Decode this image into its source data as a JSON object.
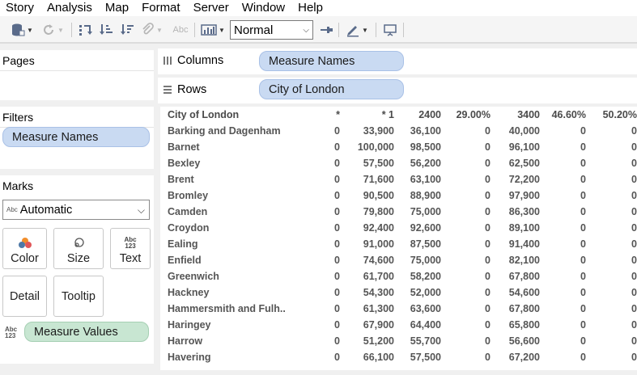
{
  "menu": [
    "Story",
    "Analysis",
    "Map",
    "Format",
    "Server",
    "Window",
    "Help"
  ],
  "toolbar": {
    "fit": "Normal",
    "abc_label": "Abc"
  },
  "panels": {
    "pages": "Pages",
    "filters": "Filters",
    "marks": "Marks"
  },
  "filters": {
    "pill": "Measure Names"
  },
  "marks": {
    "type": "Automatic",
    "type_icon": "Abc",
    "buttons": {
      "color": "Color",
      "size": "Size",
      "text": "Text",
      "detail": "Detail",
      "tooltip": "Tooltip"
    },
    "text_icon_top": "Abc",
    "text_icon_bottom": "123",
    "measure_values_pill": "Measure Values"
  },
  "shelves": {
    "columns_label": "Columns",
    "columns_pill": "Measure Names",
    "rows_label": "Rows",
    "rows_pill": "City of London"
  },
  "table": {
    "headers": [
      "City of London",
      "*",
      "* 1",
      "2400",
      "29.00%",
      "3400",
      "46.60%",
      "50.20%"
    ],
    "rows": [
      [
        "Barking and Dagenham",
        "0",
        "33,900",
        "36,100",
        "0",
        "40,000",
        "0",
        "0"
      ],
      [
        "Barnet",
        "0",
        "100,000",
        "98,500",
        "0",
        "96,100",
        "0",
        "0"
      ],
      [
        "Bexley",
        "0",
        "57,500",
        "56,200",
        "0",
        "62,500",
        "0",
        "0"
      ],
      [
        "Brent",
        "0",
        "71,600",
        "63,100",
        "0",
        "72,200",
        "0",
        "0"
      ],
      [
        "Bromley",
        "0",
        "90,500",
        "88,900",
        "0",
        "97,900",
        "0",
        "0"
      ],
      [
        "Camden",
        "0",
        "79,800",
        "75,000",
        "0",
        "86,300",
        "0",
        "0"
      ],
      [
        "Croydon",
        "0",
        "92,400",
        "92,600",
        "0",
        "89,100",
        "0",
        "0"
      ],
      [
        "Ealing",
        "0",
        "91,000",
        "87,500",
        "0",
        "91,400",
        "0",
        "0"
      ],
      [
        "Enfield",
        "0",
        "74,600",
        "75,000",
        "0",
        "82,100",
        "0",
        "0"
      ],
      [
        "Greenwich",
        "0",
        "61,700",
        "58,200",
        "0",
        "67,800",
        "0",
        "0"
      ],
      [
        "Hackney",
        "0",
        "54,300",
        "52,000",
        "0",
        "54,600",
        "0",
        "0"
      ],
      [
        "Hammersmith and Fulh..",
        "0",
        "61,300",
        "63,600",
        "0",
        "67,800",
        "0",
        "0"
      ],
      [
        "Haringey",
        "0",
        "67,900",
        "64,400",
        "0",
        "65,800",
        "0",
        "0"
      ],
      [
        "Harrow",
        "0",
        "51,200",
        "55,700",
        "0",
        "56,600",
        "0",
        "0"
      ],
      [
        "Havering",
        "0",
        "66,100",
        "57,500",
        "0",
        "67,200",
        "0",
        "0"
      ]
    ]
  }
}
